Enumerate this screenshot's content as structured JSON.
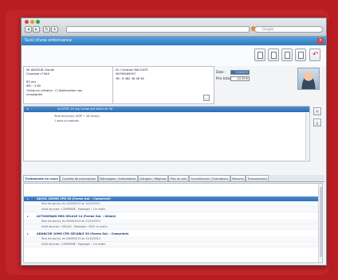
{
  "browser": {
    "dot_colors": [
      "#e0443e",
      "#dea123",
      "#2aa84a"
    ],
    "search_placeholder": "Google"
  },
  "window": {
    "title": "Suivi d'une ordonnance",
    "close_glyph": "✕"
  },
  "toolbar": {
    "buttons": [
      "document-icon",
      "document-icon",
      "document-icon",
      "document-edit-icon",
      "undo-icon"
    ]
  },
  "patient": {
    "name": "Mr ANGELIB Claude",
    "room": "Chambre n°XXX",
    "age": "83 ans",
    "imc": "IMC : 3,62",
    "clairance": "Clairance créatine : Cl éxténuation non",
    "renseignee": "renseignée"
  },
  "doctor": {
    "name": "Dr. Christian BACOUST",
    "rpps": "96799485997",
    "tel": "Tél : 6 362 36 98 36"
  },
  "dates": {
    "date_label": "Date :",
    "date_value": "11/03/13",
    "prix_label": "Prix total :",
    "prix_value": "10,70 €"
  },
  "detail": {
    "header": "ACUITEL 20 mg Comprimé Boîte de 30",
    "lines": [
      "Tous les jour(s) (GDP + 28 (kurs)).",
      "1 dans la matinée."
    ]
  },
  "tabs": [
    "Traitements en cours",
    "Contrôle de prescription",
    "Pathologies / Antécédents",
    "Allergies / Régimes",
    "Plan de soin",
    "Surveillances / Evaluations",
    "Mesures",
    "Transmissions"
  ],
  "treatments": [
    {
      "name": "AD/VIL 200MG CPR 30 (Forme Gal. : Comprimé)",
      "line1": "Tous les jour(s), du 22/09/2013 au 10/10/2013",
      "line2": "Unité de prise : COMPRIMÉ - Posologie : 1 le matin."
    },
    {
      "name": "ACTISKENAN 5MG GELULE 14 (Forme Gal. : Gélule)",
      "line1": "Tous les jour(s), du 04/09/2013 au 21/10/2013",
      "line2": "Unité de prise : GÉLULE - Posologie : GÉLE- le matin."
    },
    {
      "name": "ADANCOR 10MG CPR SECABLE 30 (Forme Gal. : Comprimé)",
      "line1": "Tous les jour(s), du 04/09/2013 au 21/10/2013",
      "line2": "Unité de prise : COMPRIMÉ - Posologie : 1 le matin."
    }
  ],
  "icons": {
    "expand_marker": "▸",
    "plus": "+",
    "download": "⤓",
    "undo": "↶"
  }
}
